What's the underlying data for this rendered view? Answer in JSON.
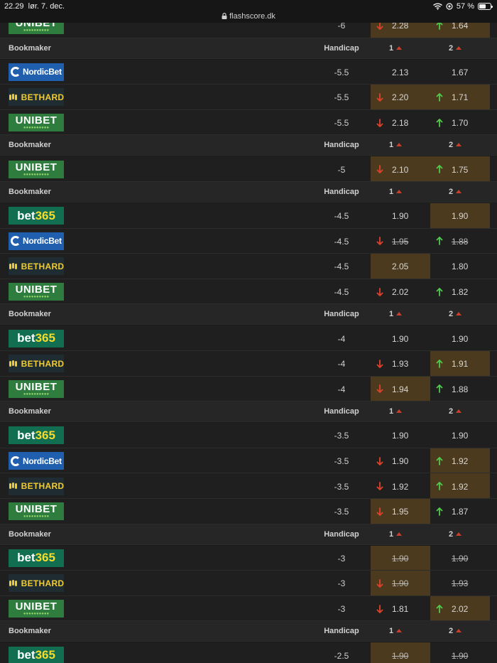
{
  "status_bar": {
    "time": "22.29",
    "date": "lør. 7. dec.",
    "url": "flashscore.dk",
    "battery": "57 %",
    "battery_level": 0.57
  },
  "table": {
    "header_labels": {
      "bookmaker": "Bookmaker",
      "handicap": "Handicap",
      "col1": "1",
      "col2": "2"
    },
    "groups": [
      {
        "handicap_group": "-6",
        "show_header": false,
        "rows": [
          {
            "bookmaker": "UNIBET",
            "logo": "unibet",
            "handicap": "-6",
            "odds1": {
              "value": "2.28",
              "trend": "down",
              "highlight": true,
              "strike": false
            },
            "odds2": {
              "value": "1.64",
              "trend": "up",
              "highlight": true,
              "strike": false
            }
          }
        ]
      },
      {
        "show_header": true,
        "rows": [
          {
            "bookmaker": "NordicBet",
            "logo": "nordicbet",
            "handicap": "-5.5",
            "odds1": {
              "value": "2.13",
              "trend": "none",
              "highlight": false,
              "strike": false
            },
            "odds2": {
              "value": "1.67",
              "trend": "none",
              "highlight": false,
              "strike": false
            }
          },
          {
            "bookmaker": "BETHARD",
            "logo": "bethard",
            "handicap": "-5.5",
            "odds1": {
              "value": "2.20",
              "trend": "down",
              "highlight": true,
              "strike": false
            },
            "odds2": {
              "value": "1.71",
              "trend": "up",
              "highlight": true,
              "strike": false
            }
          },
          {
            "bookmaker": "UNIBET",
            "logo": "unibet",
            "handicap": "-5.5",
            "odds1": {
              "value": "2.18",
              "trend": "down",
              "highlight": false,
              "strike": false
            },
            "odds2": {
              "value": "1.70",
              "trend": "up",
              "highlight": false,
              "strike": false
            }
          }
        ]
      },
      {
        "show_header": true,
        "rows": [
          {
            "bookmaker": "UNIBET",
            "logo": "unibet",
            "handicap": "-5",
            "odds1": {
              "value": "2.10",
              "trend": "down",
              "highlight": true,
              "strike": false
            },
            "odds2": {
              "value": "1.75",
              "trend": "up",
              "highlight": true,
              "strike": false
            }
          }
        ]
      },
      {
        "show_header": true,
        "rows": [
          {
            "bookmaker": "bet365",
            "logo": "bet365",
            "handicap": "-4.5",
            "odds1": {
              "value": "1.90",
              "trend": "none",
              "highlight": false,
              "strike": false
            },
            "odds2": {
              "value": "1.90",
              "trend": "none",
              "highlight": true,
              "strike": false
            }
          },
          {
            "bookmaker": "NordicBet",
            "logo": "nordicbet",
            "handicap": "-4.5",
            "odds1": {
              "value": "1.95",
              "trend": "down",
              "highlight": false,
              "strike": true
            },
            "odds2": {
              "value": "1.88",
              "trend": "up",
              "highlight": false,
              "strike": true
            }
          },
          {
            "bookmaker": "BETHARD",
            "logo": "bethard",
            "handicap": "-4.5",
            "odds1": {
              "value": "2.05",
              "trend": "none",
              "highlight": true,
              "strike": false
            },
            "odds2": {
              "value": "1.80",
              "trend": "none",
              "highlight": false,
              "strike": false
            }
          },
          {
            "bookmaker": "UNIBET",
            "logo": "unibet",
            "handicap": "-4.5",
            "odds1": {
              "value": "2.02",
              "trend": "down",
              "highlight": false,
              "strike": false
            },
            "odds2": {
              "value": "1.82",
              "trend": "up",
              "highlight": false,
              "strike": false
            }
          }
        ]
      },
      {
        "show_header": true,
        "rows": [
          {
            "bookmaker": "bet365",
            "logo": "bet365",
            "handicap": "-4",
            "odds1": {
              "value": "1.90",
              "trend": "none",
              "highlight": false,
              "strike": false
            },
            "odds2": {
              "value": "1.90",
              "trend": "none",
              "highlight": false,
              "strike": false
            }
          },
          {
            "bookmaker": "BETHARD",
            "logo": "bethard",
            "handicap": "-4",
            "odds1": {
              "value": "1.93",
              "trend": "down",
              "highlight": false,
              "strike": false
            },
            "odds2": {
              "value": "1.91",
              "trend": "up",
              "highlight": true,
              "strike": false
            }
          },
          {
            "bookmaker": "UNIBET",
            "logo": "unibet",
            "handicap": "-4",
            "odds1": {
              "value": "1.94",
              "trend": "down",
              "highlight": true,
              "strike": false
            },
            "odds2": {
              "value": "1.88",
              "trend": "up",
              "highlight": false,
              "strike": false
            }
          }
        ]
      },
      {
        "show_header": true,
        "rows": [
          {
            "bookmaker": "bet365",
            "logo": "bet365",
            "handicap": "-3.5",
            "odds1": {
              "value": "1.90",
              "trend": "none",
              "highlight": false,
              "strike": false
            },
            "odds2": {
              "value": "1.90",
              "trend": "none",
              "highlight": false,
              "strike": false
            }
          },
          {
            "bookmaker": "NordicBet",
            "logo": "nordicbet",
            "handicap": "-3.5",
            "odds1": {
              "value": "1.90",
              "trend": "down",
              "highlight": false,
              "strike": false
            },
            "odds2": {
              "value": "1.92",
              "trend": "up",
              "highlight": true,
              "strike": false
            }
          },
          {
            "bookmaker": "BETHARD",
            "logo": "bethard",
            "handicap": "-3.5",
            "odds1": {
              "value": "1.92",
              "trend": "down",
              "highlight": false,
              "strike": false
            },
            "odds2": {
              "value": "1.92",
              "trend": "up",
              "highlight": true,
              "strike": false
            }
          },
          {
            "bookmaker": "UNIBET",
            "logo": "unibet",
            "handicap": "-3.5",
            "odds1": {
              "value": "1.95",
              "trend": "down",
              "highlight": true,
              "strike": false
            },
            "odds2": {
              "value": "1.87",
              "trend": "up",
              "highlight": false,
              "strike": false
            }
          }
        ]
      },
      {
        "show_header": true,
        "rows": [
          {
            "bookmaker": "bet365",
            "logo": "bet365",
            "handicap": "-3",
            "odds1": {
              "value": "1.90",
              "trend": "none",
              "highlight": true,
              "strike": true
            },
            "odds2": {
              "value": "1.90",
              "trend": "none",
              "highlight": false,
              "strike": true
            }
          },
          {
            "bookmaker": "BETHARD",
            "logo": "bethard",
            "handicap": "-3",
            "odds1": {
              "value": "1.90",
              "trend": "down",
              "highlight": true,
              "strike": true
            },
            "odds2": {
              "value": "1.93",
              "trend": "none",
              "highlight": false,
              "strike": true
            }
          },
          {
            "bookmaker": "UNIBET",
            "logo": "unibet",
            "handicap": "-3",
            "odds1": {
              "value": "1.81",
              "trend": "down",
              "highlight": false,
              "strike": false
            },
            "odds2": {
              "value": "2.02",
              "trend": "up",
              "highlight": true,
              "strike": false
            }
          }
        ]
      },
      {
        "show_header": true,
        "rows": [
          {
            "bookmaker": "bet365",
            "logo": "bet365",
            "handicap": "-2.5",
            "odds1": {
              "value": "1.90",
              "trend": "none",
              "highlight": true,
              "strike": true
            },
            "odds2": {
              "value": "1.90",
              "trend": "none",
              "highlight": false,
              "strike": true
            }
          }
        ]
      }
    ]
  },
  "colors": {
    "arrow_down": "#e0412b",
    "arrow_up": "#52c94a",
    "highlight": "#4b3a1e",
    "unibet_green": "#2e7c3e",
    "bet365_green": "#126e51",
    "bet365_yellow": "#f5dc2c",
    "nordicbet_blue": "#1f5fae",
    "bethard_yellow": "#f1cb2f"
  }
}
